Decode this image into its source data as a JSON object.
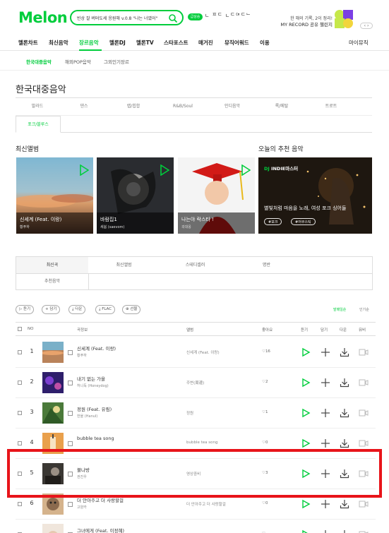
{
  "header": {
    "logo": "Melon",
    "search": {
      "value": "빈상 잘 버텨도세 응원해 v.0.8 \"나는 너였어\"",
      "placeholder": ""
    },
    "badge": "급상승",
    "ticker": "ㄴ ᄑᄃ  ㄴᄃᄃᄇᄃᄂ",
    "promo_line1": "한 해의 기록, 2이 정리!",
    "promo_line2": "MY RECORD 공유 챌린지",
    "promo_arrows": "‹ ›"
  },
  "gnb": {
    "items": [
      "멜론차트",
      "최신음악",
      "장르음악",
      "멜론DJ",
      "멜론TV",
      "스타포스트",
      "매거진",
      "뮤직어워드",
      "이용"
    ],
    "mymusic": "마이뮤직"
  },
  "lnb": {
    "items": [
      "한국대중음악",
      "해외POP음악",
      "그외인기장르"
    ]
  },
  "page_title": "한국대중음악",
  "genres": {
    "row1": [
      "발라드",
      "댄스",
      "랩/힙합",
      "R&B/Soul",
      "인디음악",
      "록/메탈",
      "트로트"
    ],
    "row2": [
      "포크/블루스"
    ]
  },
  "new_albums": {
    "title": "최신앨범",
    "albums": [
      {
        "title": "신세계 (Feat. 이랑)",
        "artist": "황푸하"
      },
      {
        "title": "바람집1",
        "artist": "새봄 (saevom)"
      },
      {
        "title": "나는야 락스타 !",
        "artist": "곽대웅"
      }
    ]
  },
  "recommend": {
    "title": "오늘의 추천 음악",
    "dj": "INDIE마스터",
    "desc": "별빛처럼 마음을 노래, 여성 포크 싱어들",
    "tags": [
      "#포크",
      "#어쿠스틱"
    ]
  },
  "tabs": {
    "row1": [
      "최신곡",
      "최신앨범",
      "스테디셀러",
      "명반"
    ],
    "row2": [
      "추천음악"
    ]
  },
  "toolbar": {
    "buttons": [
      "듣기",
      "담기",
      "다운",
      "FLAC",
      "선물"
    ],
    "sort": [
      "발매일순",
      "인기순"
    ]
  },
  "table": {
    "headers": [
      "NO",
      "곡정보",
      "앨범",
      "좋아요",
      "듣기",
      "담기",
      "다운",
      "뮤비"
    ],
    "rows": [
      {
        "rank": "1",
        "song": "신세계 (Feat. 이랑)",
        "artist": "황푸하",
        "album": "신세계 (Feat. 이랑)",
        "likes": "16"
      },
      {
        "rank": "2",
        "song": "내기 없는 가을",
        "artist": "허니독 (Honeydog)",
        "album": "주변(周邊)",
        "likes": "2"
      },
      {
        "rank": "3",
        "song": "정원 (Feat. 유림)",
        "artist": "한울 (Hanul)",
        "album": "정원",
        "likes": "1"
      },
      {
        "rank": "4",
        "song": "bubble tea song",
        "artist": "",
        "album": "bubble tea song",
        "likes": "0"
      },
      {
        "rank": "5",
        "song": "불나방",
        "artist": "권진우",
        "album": "영상중비",
        "likes": "3"
      },
      {
        "rank": "6",
        "song": "더 안아주고 더 사랑할걸",
        "artist": "고양카",
        "album": "더 안아주고 더 사랑할걸",
        "likes": "0"
      },
      {
        "rank": "",
        "song": "그녀에게 (Feat. 이정혜)",
        "artist": "",
        "album": "",
        "likes": ""
      }
    ]
  },
  "colors": {
    "accent": "#00cd3c",
    "highlight": "#e8141a"
  }
}
